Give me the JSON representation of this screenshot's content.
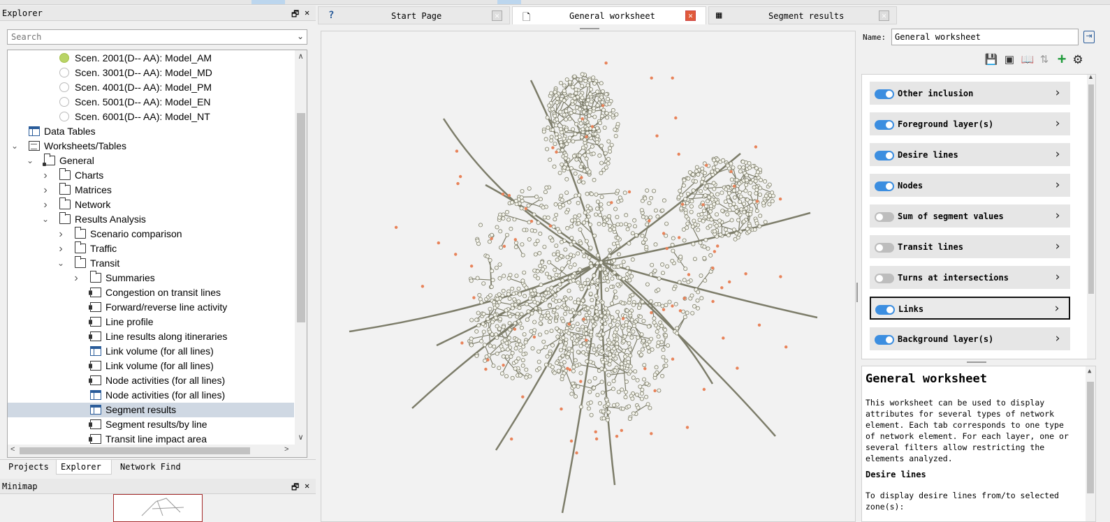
{
  "explorer": {
    "title": "Explorer",
    "search_placeholder": "Search",
    "tree": [
      {
        "label": "Scen. 2001(D-- AA): Model_AM",
        "indent": 3,
        "icon": "scenario-active-icon",
        "twisty": ""
      },
      {
        "label": "Scen. 3001(D-- AA): Model_MD",
        "indent": 3,
        "icon": "scenario-icon",
        "twisty": ""
      },
      {
        "label": "Scen. 4001(D-- AA): Model_PM",
        "indent": 3,
        "icon": "scenario-icon",
        "twisty": ""
      },
      {
        "label": "Scen. 5001(D-- AA): Model_EN",
        "indent": 3,
        "icon": "scenario-icon",
        "twisty": ""
      },
      {
        "label": "Scen. 6001(D-- AA): Model_NT",
        "indent": 3,
        "icon": "scenario-icon",
        "twisty": ""
      },
      {
        "label": "Data Tables",
        "indent": 1,
        "icon": "table-icon",
        "twisty": ""
      },
      {
        "label": "Worksheets/Tables",
        "indent": 1,
        "icon": "worksheets-icon",
        "twisty": "v"
      },
      {
        "label": "General",
        "indent": 2,
        "icon": "worksheet-folder-icon",
        "twisty": "v"
      },
      {
        "label": "Charts",
        "indent": 3,
        "icon": "folder-icon",
        "twisty": ">"
      },
      {
        "label": "Matrices",
        "indent": 3,
        "icon": "folder-icon",
        "twisty": ">"
      },
      {
        "label": "Network",
        "indent": 3,
        "icon": "folder-icon",
        "twisty": ">"
      },
      {
        "label": "Results Analysis",
        "indent": 3,
        "icon": "folder-icon",
        "twisty": "v"
      },
      {
        "label": "Scenario comparison",
        "indent": 4,
        "icon": "folder-icon",
        "twisty": ">"
      },
      {
        "label": "Traffic",
        "indent": 4,
        "icon": "folder-icon",
        "twisty": ">"
      },
      {
        "label": "Transit",
        "indent": 4,
        "icon": "folder-icon",
        "twisty": "v"
      },
      {
        "label": "Summaries",
        "indent": 5,
        "icon": "folder-icon",
        "twisty": ">"
      },
      {
        "label": "Congestion on transit lines",
        "indent": 5,
        "icon": "worksheet-icon",
        "twisty": ""
      },
      {
        "label": "Forward/reverse line activity",
        "indent": 5,
        "icon": "worksheet-icon",
        "twisty": ""
      },
      {
        "label": "Line profile",
        "indent": 5,
        "icon": "worksheet-icon",
        "twisty": ""
      },
      {
        "label": "Line results along itineraries",
        "indent": 5,
        "icon": "worksheet-icon",
        "twisty": ""
      },
      {
        "label": "Link volume (for all lines)",
        "indent": 5,
        "icon": "table-icon",
        "twisty": ""
      },
      {
        "label": "Link volume (for all lines)",
        "indent": 5,
        "icon": "worksheet-icon",
        "twisty": ""
      },
      {
        "label": "Node activities (for all lines)",
        "indent": 5,
        "icon": "worksheet-icon",
        "twisty": ""
      },
      {
        "label": "Node activities (for all lines)",
        "indent": 5,
        "icon": "table-icon",
        "twisty": ""
      },
      {
        "label": "Segment results",
        "indent": 5,
        "icon": "table-icon",
        "twisty": "",
        "selected": true
      },
      {
        "label": "Segment results/by line",
        "indent": 5,
        "icon": "worksheet-icon",
        "twisty": ""
      },
      {
        "label": "Transit line impact area",
        "indent": 5,
        "icon": "worksheet-icon",
        "twisty": ""
      }
    ]
  },
  "bottom_tabs": [
    "Projects",
    "Explorer",
    "Network Find"
  ],
  "minimap": {
    "title": "Minimap"
  },
  "doc_tabs": [
    {
      "label": "Start Page",
      "icon": "help-icon"
    },
    {
      "label": "General worksheet",
      "icon": "worksheet-icon",
      "active": true
    },
    {
      "label": "Segment results",
      "icon": "table-icon"
    }
  ],
  "right_panel": {
    "name_label": "Name:",
    "name_value": "General worksheet",
    "layers": [
      {
        "label": "Other inclusion",
        "on": true
      },
      {
        "label": "Foreground layer(s)",
        "on": true
      },
      {
        "label": "Desire lines",
        "on": true
      },
      {
        "label": "Nodes",
        "on": true
      },
      {
        "label": "Sum of segment values",
        "on": false
      },
      {
        "label": "Transit lines",
        "on": false
      },
      {
        "label": "Turns at intersections",
        "on": false
      },
      {
        "label": "Links",
        "on": true,
        "focused": true
      },
      {
        "label": "Background layer(s)",
        "on": true
      }
    ],
    "help": {
      "title": "General worksheet",
      "intro": "This worksheet can be used to display attributes for several types of network element. Each tab corresponds to one type of network element. For each layer, one or several filters allow restricting the elements analyzed.",
      "section_title": "Desire lines",
      "section_text": "To display desire lines from/to selected zone(s):"
    }
  },
  "colors": {
    "accent": "#3c8ee0",
    "network_link": "#7d7d6a",
    "network_node": "#c9c9b2",
    "centroid": "#e8835a",
    "selection": "#cfd8e3",
    "add_green": "#1f9a3a",
    "close_red": "#e05a3a"
  }
}
